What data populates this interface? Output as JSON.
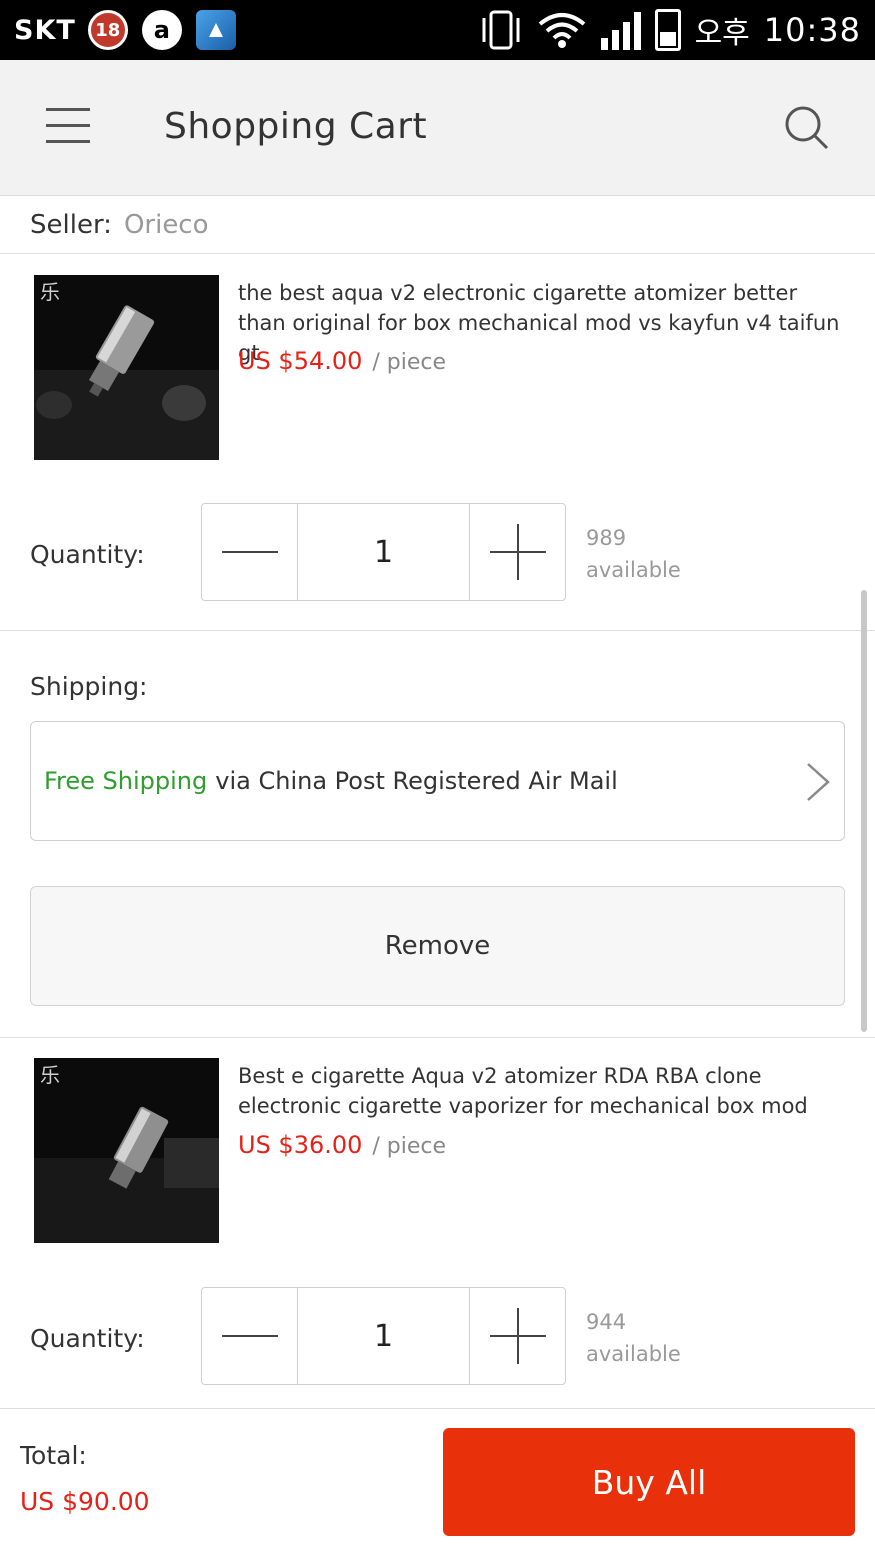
{
  "status_bar": {
    "carrier": "SKT",
    "notification_count": "18",
    "ampm": "오후",
    "time": "10:38"
  },
  "app_bar": {
    "title": "Shopping Cart",
    "menu_icon": "hamburger-menu-icon",
    "search_icon": "search-icon"
  },
  "seller": {
    "label": "Seller:",
    "name": "Orieco"
  },
  "items": [
    {
      "title": "the best aqua v2 electronic cigarette atomizer better than original for box mechanical mod vs kayfun v4 taifun gt",
      "price": "US $54.00",
      "unit": "/  piece",
      "quantity_label": "Quantity:",
      "quantity": "1",
      "available_count": "989",
      "available_label": "available"
    },
    {
      "title": "Best e cigarette Aqua v2 atomizer RDA RBA clone electronic cigarette vaporizer  for mechanical box mod",
      "price": "US $36.00",
      "unit": "/  piece",
      "quantity_label": "Quantity:",
      "quantity": "1",
      "available_count": "944",
      "available_label": "available"
    }
  ],
  "shipping": {
    "label": "Shipping:",
    "free": "Free Shipping",
    "method": "via China Post Registered Air Mail"
  },
  "remove_label": "Remove",
  "footer": {
    "total_label": "Total:",
    "total_value": "US $90.00",
    "buy_label": "Buy All"
  },
  "colors": {
    "accent": "#e8300a",
    "price": "#e62117",
    "free_shipping": "#2e9e2e"
  }
}
